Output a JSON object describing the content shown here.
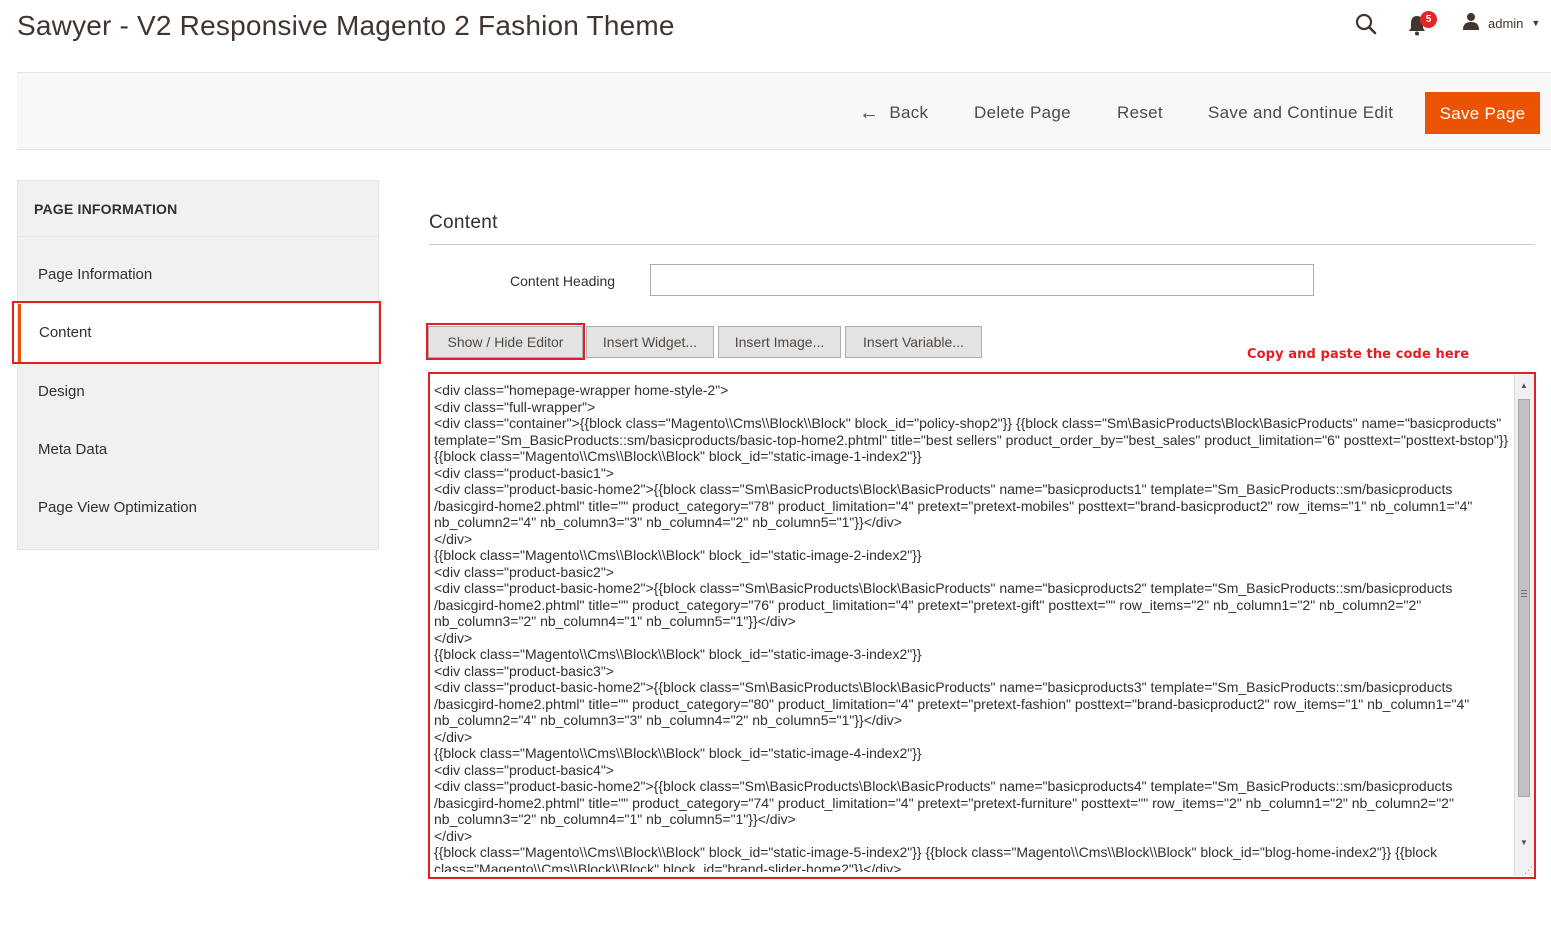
{
  "header": {
    "title": "Sawyer - V2 Responsive Magento 2 Fashion Theme",
    "notifications_count": "5",
    "user_name": "admin",
    "icons": [
      "search-icon",
      "bell-icon",
      "user-icon",
      "caret-down-icon"
    ]
  },
  "toolbar": {
    "back_label": "Back",
    "delete_label": "Delete Page",
    "reset_label": "Reset",
    "save_continue_label": "Save and Continue Edit",
    "save_label": "Save Page",
    "accent_color": "#eb5202"
  },
  "sidebar": {
    "title": "PAGE INFORMATION",
    "items": [
      {
        "label": "Page Information"
      },
      {
        "label": "Content"
      },
      {
        "label": "Design"
      },
      {
        "label": "Meta Data"
      },
      {
        "label": "Page View Optimization"
      }
    ],
    "active_item": "Content"
  },
  "content": {
    "section_title": "Content",
    "heading_label": "Content Heading",
    "heading_value": "",
    "buttons": {
      "show_hide": "Show / Hide Editor",
      "insert_widget": "Insert Widget...",
      "insert_image": "Insert Image...",
      "insert_variable": "Insert Variable..."
    },
    "annotation": "Copy and paste the code here",
    "annotation_color": "#e41c23",
    "code": "<div class=\"homepage-wrapper home-style-2\">\n<div class=\"full-wrapper\">\n<div class=\"container\">{{block class=\"Magento\\\\Cms\\\\Block\\\\Block\" block_id=\"policy-shop2\"}} {{block class=\"Sm\\BasicProducts\\Block\\BasicProducts\" name=\"basicproducts\" template=\"Sm_BasicProducts::sm/basicproducts/basic-top-home2.phtml\" title=\"best sellers\" product_order_by=\"best_sales\" product_limitation=\"6\" posttext=\"posttext-bstop\"}} {{block class=\"Magento\\\\Cms\\\\Block\\\\Block\" block_id=\"static-image-1-index2\"}}\n<div class=\"product-basic1\">\n<div class=\"product-basic-home2\">{{block class=\"Sm\\BasicProducts\\Block\\BasicProducts\" name=\"basicproducts1\" template=\"Sm_BasicProducts::sm/basicproducts /basicgird-home2.phtml\" title=\"\" product_category=\"78\" product_limitation=\"4\" pretext=\"pretext-mobiles\" posttext=\"brand-basicproduct2\" row_items=\"1\" nb_column1=\"4\" nb_column2=\"4\" nb_column3=\"3\" nb_column4=\"2\" nb_column5=\"1\"}}</div>\n</div>\n{{block class=\"Magento\\\\Cms\\\\Block\\\\Block\" block_id=\"static-image-2-index2\"}}\n<div class=\"product-basic2\">\n<div class=\"product-basic-home2\">{{block class=\"Sm\\BasicProducts\\Block\\BasicProducts\" name=\"basicproducts2\" template=\"Sm_BasicProducts::sm/basicproducts /basicgird-home2.phtml\" title=\"\" product_category=\"76\" product_limitation=\"4\" pretext=\"pretext-gift\" posttext=\"\" row_items=\"2\" nb_column1=\"2\" nb_column2=\"2\" nb_column3=\"2\" nb_column4=\"1\" nb_column5=\"1\"}}</div>\n</div>\n{{block class=\"Magento\\\\Cms\\\\Block\\\\Block\" block_id=\"static-image-3-index2\"}}\n<div class=\"product-basic3\">\n<div class=\"product-basic-home2\">{{block class=\"Sm\\BasicProducts\\Block\\BasicProducts\" name=\"basicproducts3\" template=\"Sm_BasicProducts::sm/basicproducts /basicgird-home2.phtml\" title=\"\" product_category=\"80\" product_limitation=\"4\" pretext=\"pretext-fashion\" posttext=\"brand-basicproduct2\" row_items=\"1\" nb_column1=\"4\" nb_column2=\"4\" nb_column3=\"3\" nb_column4=\"2\" nb_column5=\"1\"}}</div>\n</div>\n{{block class=\"Magento\\\\Cms\\\\Block\\\\Block\" block_id=\"static-image-4-index2\"}}\n<div class=\"product-basic4\">\n<div class=\"product-basic-home2\">{{block class=\"Sm\\BasicProducts\\Block\\BasicProducts\" name=\"basicproducts4\" template=\"Sm_BasicProducts::sm/basicproducts /basicgird-home2.phtml\" title=\"\" product_category=\"74\" product_limitation=\"4\" pretext=\"pretext-furniture\" posttext=\"\" row_items=\"2\" nb_column1=\"2\" nb_column2=\"2\" nb_column3=\"2\" nb_column4=\"1\" nb_column5=\"1\"}}</div>\n</div>\n{{block class=\"Magento\\\\Cms\\\\Block\\\\Block\" block_id=\"static-image-5-index2\"}} {{block class=\"Magento\\\\Cms\\\\Block\\\\Block\" block_id=\"blog-home-index2\"}} {{block class=\"Magento\\\\Cms\\\\Block\\\\Block\" block_id=\"brand-slider-home2\"}}</div>"
  }
}
